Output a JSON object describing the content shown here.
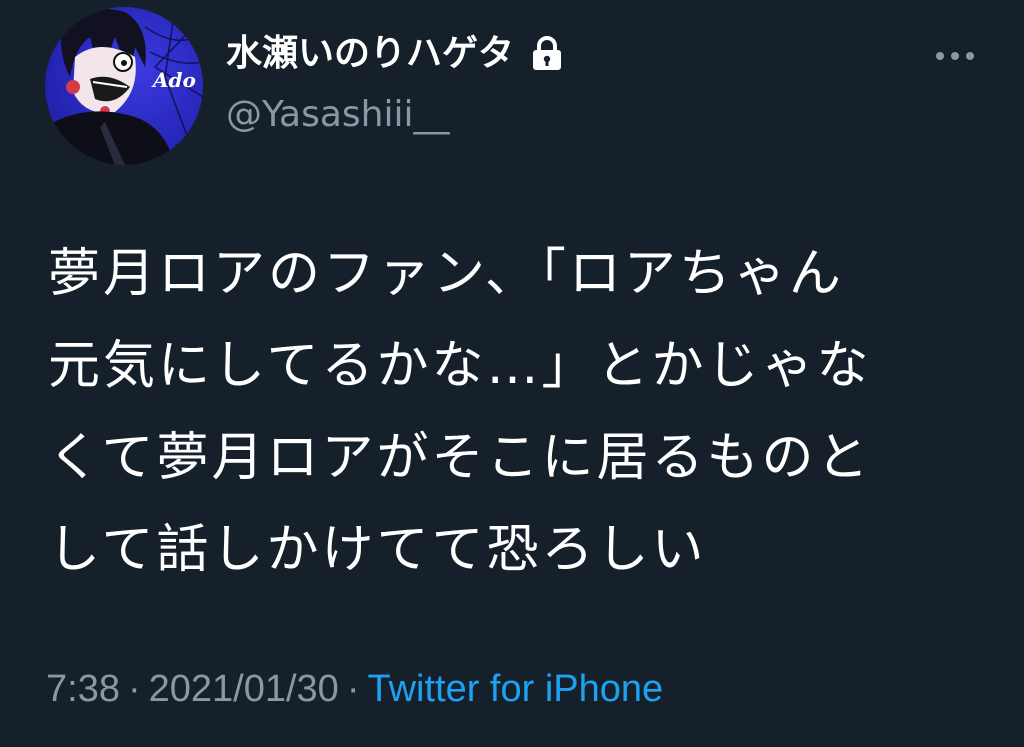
{
  "colors": {
    "background": "#15202b",
    "primary_text": "#ffffff",
    "secondary_text": "#8899a6",
    "accent": "#1da1f2"
  },
  "author": {
    "display_name": "水瀬いのりハゲタ",
    "handle": "@Yasashiii__",
    "avatar_badge": "Ado",
    "protected_icon": "lock-icon"
  },
  "more_icon": "more-horizontal-icon",
  "tweet": {
    "lines": [
      "夢月ロアのファン、「ロアちゃん",
      "元気にしてるかな…」とかじゃな",
      "くて夢月ロアがそこに居るものと",
      "して話しかけてて恐ろしい"
    ]
  },
  "meta": {
    "time": "7:38",
    "separator": "·",
    "date": "2021/01/30",
    "source": "Twitter for iPhone"
  }
}
